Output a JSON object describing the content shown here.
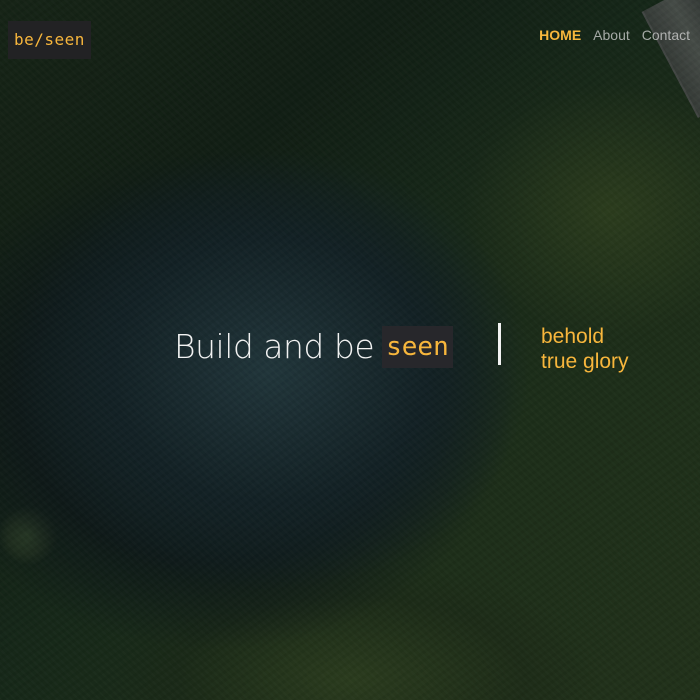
{
  "header": {
    "logo_text": "be/seen",
    "nav": {
      "home": "HOME",
      "about": "About",
      "contact": "Contact"
    }
  },
  "hero": {
    "headline_main": "Build and be",
    "headline_accent": "seen",
    "tagline_line1": "behold",
    "tagline_line2": "true glory"
  },
  "colors": {
    "accent": "#f7b63c",
    "text_primary": "#f2f2f2",
    "nav_muted": "#b7b7b7",
    "logo_background": "#222224",
    "highlight_background": "#27272b"
  }
}
